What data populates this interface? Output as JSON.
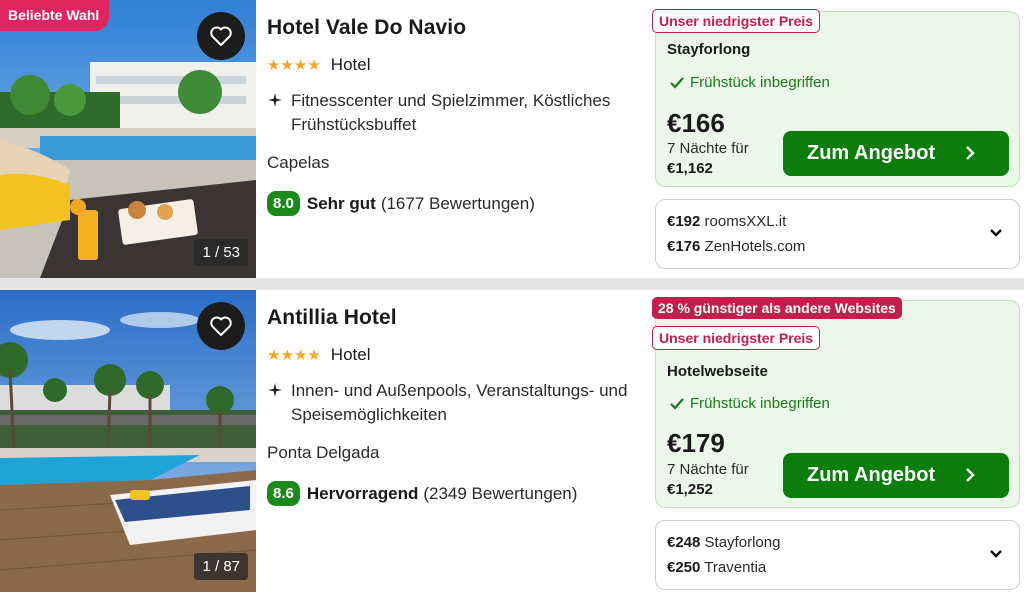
{
  "hotels": [
    {
      "popular_badge": "Beliebte Wahl",
      "favorite_icon": "heart-outline-icon",
      "photo_counter": "1 / 53",
      "name": "Hotel Vale Do Navio",
      "stars": "★★★★",
      "star_count": 4,
      "type": "Hotel",
      "amenities": "Fitnesscenter und Spielzimmer, Köstliches Frühstücksbuffet",
      "city": "Capelas",
      "score": "8.0",
      "rating_label": "Sehr gut",
      "review_count": "(1677 Bewertungen)",
      "offer": {
        "lowest_tag": "Unser niedrigster Preis",
        "provider": "Stayforlong",
        "breakfast": "Frühstück inbegriffen",
        "price": "€166",
        "nights_label": "7 Nächte für",
        "total": "€1,162",
        "cta": "Zum Angebot"
      },
      "other_offers": [
        {
          "price": "€192",
          "site": "roomsXXL.it"
        },
        {
          "price": "€176",
          "site": "ZenHotels.com"
        }
      ]
    },
    {
      "favorite_icon": "heart-outline-icon",
      "photo_counter": "1 / 87",
      "name": "Antillia Hotel",
      "stars": "★★★★",
      "star_count": 4,
      "type": "Hotel",
      "amenities": "Innen- und Außenpools, Veranstaltungs- und Speisemöglichkeiten",
      "city": "Ponta Delgada",
      "score": "8.6",
      "rating_label": "Hervorragend",
      "review_count": "(2349 Bewertungen)",
      "offer": {
        "cheaper_tag": "28 % günstiger als andere Websites",
        "lowest_tag": "Unser niedrigster Preis",
        "provider": "Hotelwebseite",
        "breakfast": "Frühstück inbegriffen",
        "price": "€179",
        "nights_label": "7 Nächte für",
        "total": "€1,252",
        "cta": "Zum Angebot"
      },
      "other_offers": [
        {
          "price": "€248",
          "site": "Stayforlong"
        },
        {
          "price": "€250",
          "site": "Traventia"
        }
      ]
    }
  ],
  "colors": {
    "accent_green": "#0a7d0a",
    "tag_red": "#c41e4a",
    "popular_pink": "#e0245e",
    "star_orange": "#f5a623",
    "offer_bg": "#ebf7e9"
  }
}
